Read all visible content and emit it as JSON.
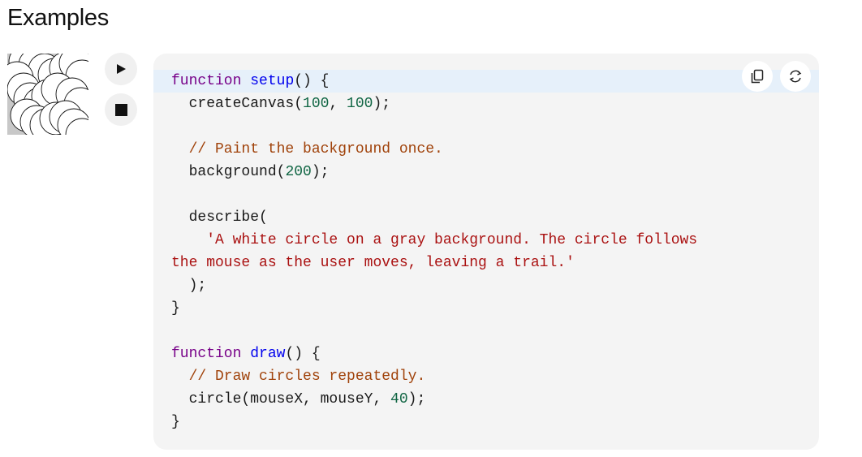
{
  "section": {
    "title": "Examples"
  },
  "controls": {
    "play_icon": "play-icon",
    "stop_icon": "stop-icon"
  },
  "toolbar": {
    "copy_icon": "copy-icon",
    "reset_icon": "refresh-icon"
  },
  "code": {
    "lines": [
      [
        {
          "t": "function",
          "c": "kw"
        },
        {
          "t": " "
        },
        {
          "t": "setup",
          "c": "fn"
        },
        {
          "t": "() {"
        }
      ],
      [
        {
          "t": "  createCanvas("
        },
        {
          "t": "100",
          "c": "num"
        },
        {
          "t": ", "
        },
        {
          "t": "100",
          "c": "num"
        },
        {
          "t": ");"
        }
      ],
      [],
      [
        {
          "t": "  // Paint the background once.",
          "c": "cm"
        }
      ],
      [
        {
          "t": "  background("
        },
        {
          "t": "200",
          "c": "num"
        },
        {
          "t": ");"
        }
      ],
      [],
      [
        {
          "t": "  describe("
        }
      ],
      [
        {
          "t": "    'A white circle on a gray background. The circle follows",
          "c": "str"
        }
      ],
      [
        {
          "t": "the mouse as the user moves, leaving a trail.'",
          "c": "str"
        }
      ],
      [
        {
          "t": "  );"
        }
      ],
      [
        {
          "t": "}"
        }
      ],
      [],
      [
        {
          "t": "function",
          "c": "kw"
        },
        {
          "t": " "
        },
        {
          "t": "draw",
          "c": "fn"
        },
        {
          "t": "() {"
        }
      ],
      [
        {
          "t": "  // Draw circles repeatedly.",
          "c": "cm"
        }
      ],
      [
        {
          "t": "  circle(mouseX, mouseY, "
        },
        {
          "t": "40",
          "c": "num"
        },
        {
          "t": ");"
        }
      ],
      [
        {
          "t": "}"
        }
      ]
    ],
    "active_line": 0
  },
  "colors": {
    "keyword": "#770088",
    "function_name": "#0000ee",
    "number": "#116644",
    "comment": "#a0420a",
    "string": "#aa1111",
    "canvas_background": "#c8c8c8"
  }
}
